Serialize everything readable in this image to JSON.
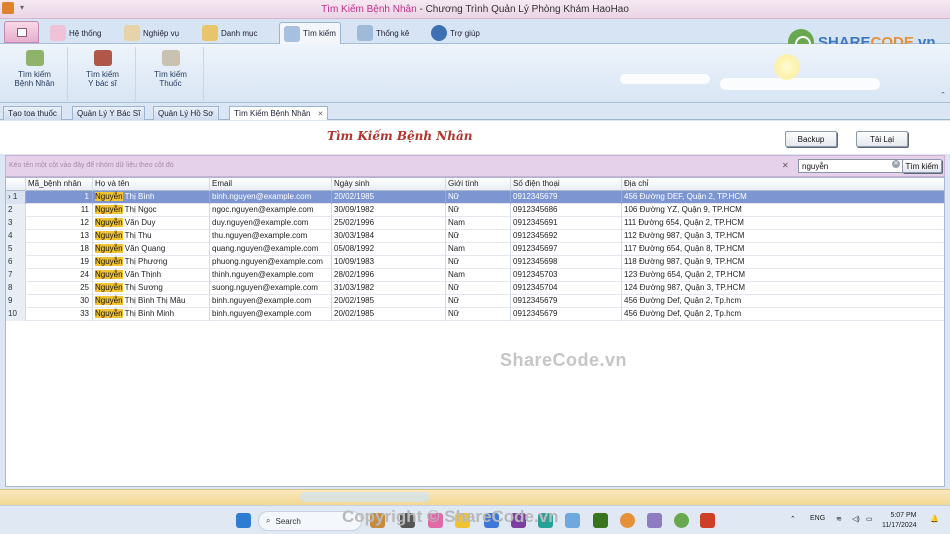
{
  "titlebar": {
    "title_app": "Tìm Kiếm Bệnh Nhân",
    "title_sep": " - ",
    "title_main": "Chương Trình Quản Lý Phòng Khám HaoHao"
  },
  "ribbon_tabs": [
    "Hệ thống",
    "Nghiệp vụ",
    "Danh mục",
    "Tìm kiếm",
    "Thống kê",
    "Trợ giúp"
  ],
  "ribbon_buttons": [
    {
      "line1": "Tìm kiếm",
      "line2": "Bệnh Nhân",
      "icon": "patients-icon"
    },
    {
      "line1": "Tìm kiếm",
      "line2": "Y bác sĩ",
      "icon": "doctor-icon"
    },
    {
      "line1": "Tìm kiếm",
      "line2": "Thuốc",
      "icon": "medicine-icon"
    }
  ],
  "doc_tabs": [
    "Tạo toa thuốc",
    "Quản Lý Y Bác Sĩ",
    "Quản Lý Hồ Sơ",
    "Tìm Kiếm Bệnh Nhân"
  ],
  "header": {
    "title": "Tìm Kiếm Bệnh Nhân",
    "backup_label": "Backup",
    "reload_label": "Tải Lại"
  },
  "groupbar": {
    "hint": "Kéo tên một cột vào đây để nhóm dữ liệu theo cột đó"
  },
  "search": {
    "value": "nguyễn",
    "button": "Tìm kiếm"
  },
  "grid": {
    "columns": [
      "Mã_bệnh nhân",
      "Họ và tên",
      "Email",
      "Ngày sinh",
      "Giới tính",
      "Số điện thoại",
      "Địa chỉ"
    ],
    "highlight": "Nguyễn",
    "rows": [
      {
        "idx": "1",
        "id": "1",
        "name_rest": " Thị Bình",
        "email": "binh.nguyen@example.com",
        "dob": "20/02/1985",
        "gender": "Nữ",
        "phone": "0912345679",
        "address": "456 Đường DEF, Quận 2, TP.HCM"
      },
      {
        "idx": "2",
        "id": "11",
        "name_rest": " Thị Ngọc",
        "email": "ngoc.nguyen@example.com",
        "dob": "30/09/1982",
        "gender": "Nữ",
        "phone": "0912345686",
        "address": "106 Đường YZ, Quận 9, TP.HCM"
      },
      {
        "idx": "3",
        "id": "12",
        "name_rest": " Văn Duy",
        "email": "duy.nguyen@example.com",
        "dob": "25/02/1996",
        "gender": "Nam",
        "phone": "0912345691",
        "address": "111 Đường 654, Quận 2, TP.HCM"
      },
      {
        "idx": "4",
        "id": "13",
        "name_rest": " Thị Thu",
        "email": "thu.nguyen@example.com",
        "dob": "30/03/1984",
        "gender": "Nữ",
        "phone": "0912345692",
        "address": "112 Đường 987, Quận 3, TP.HCM"
      },
      {
        "idx": "5",
        "id": "18",
        "name_rest": " Văn Quang",
        "email": "quang.nguyen@example.com",
        "dob": "05/08/1992",
        "gender": "Nam",
        "phone": "0912345697",
        "address": "117 Đường 654, Quận 8, TP.HCM"
      },
      {
        "idx": "6",
        "id": "19",
        "name_rest": " Thị Phương",
        "email": "phuong.nguyen@example.com",
        "dob": "10/09/1983",
        "gender": "Nữ",
        "phone": "0912345698",
        "address": "118 Đường 987, Quận 9, TP.HCM"
      },
      {
        "idx": "7",
        "id": "24",
        "name_rest": " Văn Thịnh",
        "email": "thinh.nguyen@example.com",
        "dob": "28/02/1996",
        "gender": "Nam",
        "phone": "0912345703",
        "address": "123 Đường 654, Quận 2, TP.HCM"
      },
      {
        "idx": "8",
        "id": "25",
        "name_rest": " Thị Sương",
        "email": "suong.nguyen@example.com",
        "dob": "31/03/1982",
        "gender": "Nữ",
        "phone": "0912345704",
        "address": "124 Đường 987, Quận 3, TP.HCM"
      },
      {
        "idx": "9",
        "id": "30",
        "name_rest": " Thị Bình Thị Mâu",
        "email": "binh.nguyen@example.com",
        "dob": "20/02/1985",
        "gender": "Nữ",
        "phone": "0912345679",
        "address": "456 Đường Def, Quận 2, Tp.hcm"
      },
      {
        "idx": "10",
        "id": "33",
        "name_rest": " Thị Bình Minh",
        "email": "binh.nguyen@example.com",
        "dob": "20/02/1985",
        "gender": "Nữ",
        "phone": "0912345679",
        "address": "456 Đường Def, Quận 2, Tp.hcm"
      }
    ]
  },
  "watermarks": {
    "center": "ShareCode.vn",
    "bottom": "Copyright © ShareCode.vn",
    "logo_a": "SHARE",
    "logo_b": "CODE",
    "logo_c": ".vn"
  },
  "taskbar": {
    "search_label": "Search",
    "lang": "ENG",
    "time": "5:07 PM",
    "date": "11/17/2024"
  },
  "colors": {
    "selected_row": "#7d96d2",
    "highlight": "#f1c232",
    "header_title": "#b2342b",
    "groupbar": "#e6d1ea"
  }
}
